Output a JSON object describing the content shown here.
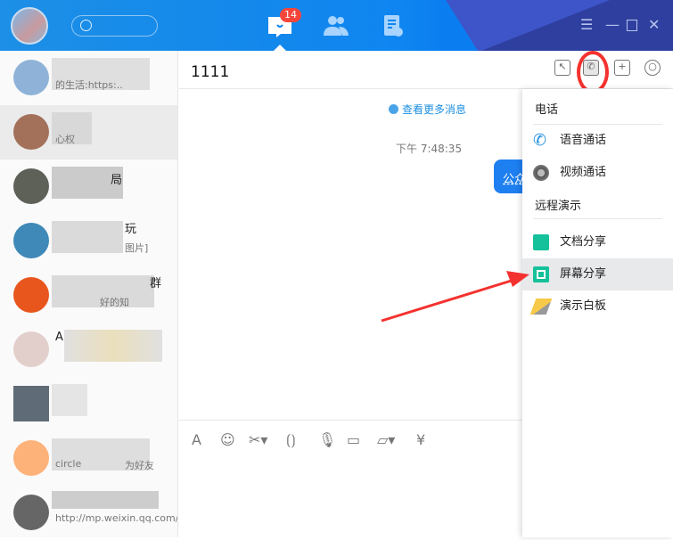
{
  "titlebar": {
    "unread_badge": "14",
    "icons": [
      "avatar",
      "search-icon",
      "message-icon",
      "contacts-icon",
      "document-icon",
      "menu-icon",
      "minimize-icon",
      "maximize-icon",
      "close-icon"
    ]
  },
  "sidebar": {
    "items": [
      {
        "snippet": "的生活:https:.."
      },
      {
        "snippet": "心权"
      },
      {
        "name": "局"
      },
      {
        "name": "玩",
        "snippet": "图片]"
      },
      {
        "name": "群",
        "snippet": "好的知"
      },
      {
        "name": "A"
      },
      {
        "name": ""
      },
      {
        "snippet": "circle",
        "snippet2": "为好友"
      },
      {
        "snippet": "http://mp.weixin.qq.com/"
      }
    ]
  },
  "chat": {
    "title": "1111",
    "more_messages": "查看更多消息",
    "timestamp": "下午 7:48:35",
    "bubble_text": "公众"
  },
  "menu": {
    "phone_header": "电话",
    "voice_call": "语音通话",
    "video_call": "视频通话",
    "remote_header": "远程演示",
    "doc_share": "文档分享",
    "screen_share": "屏幕分享",
    "whiteboard": "演示白板"
  },
  "colors": {
    "accent": "#0e85f0",
    "badge": "#f5463a",
    "annotation": "#f3322f",
    "share": "#14c19a"
  }
}
